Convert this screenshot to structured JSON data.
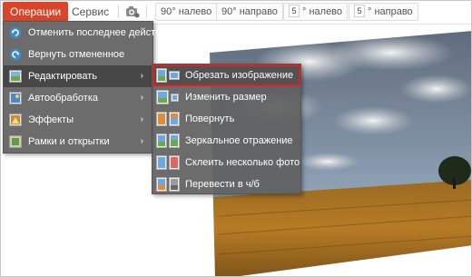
{
  "toolbar": {
    "operations_label": "Операции",
    "service_label": "Сервис",
    "rotate_left_label": "90° налево",
    "rotate_right_label": "90° направо",
    "step_left_value": "5",
    "step_left_label": "° налево",
    "step_right_value": "5",
    "step_right_label": "° направо"
  },
  "dropdown": {
    "items": [
      {
        "label": "Отменить последнее действие",
        "icon": "undo-icon"
      },
      {
        "label": "Вернуть отмененное",
        "icon": "redo-icon"
      },
      {
        "label": "Редактировать",
        "icon": "edit-icon",
        "arrow": "›"
      },
      {
        "label": "Автообработка",
        "icon": "auto-process-icon",
        "arrow": "›"
      },
      {
        "label": "Эффекты",
        "icon": "effects-icon",
        "arrow": "›"
      },
      {
        "label": "Рамки и открытки",
        "icon": "frames-icon",
        "arrow": "›"
      }
    ]
  },
  "submenu": {
    "items": [
      {
        "label": "Обрезать изображение",
        "icon": "crop-icon"
      },
      {
        "label": "Изменить размер",
        "icon": "resize-icon"
      },
      {
        "label": "Повернуть",
        "icon": "rotate-icon"
      },
      {
        "label": "Зеркальное отражение",
        "icon": "mirror-icon"
      },
      {
        "label": "Склеить несколько фото",
        "icon": "merge-photos-icon"
      },
      {
        "label": "Перевести в ч/б",
        "icon": "grayscale-icon"
      }
    ]
  },
  "colors": {
    "accent": "#d9452a",
    "highlight_outline": "#e02020",
    "menu_bg": "#606060"
  }
}
